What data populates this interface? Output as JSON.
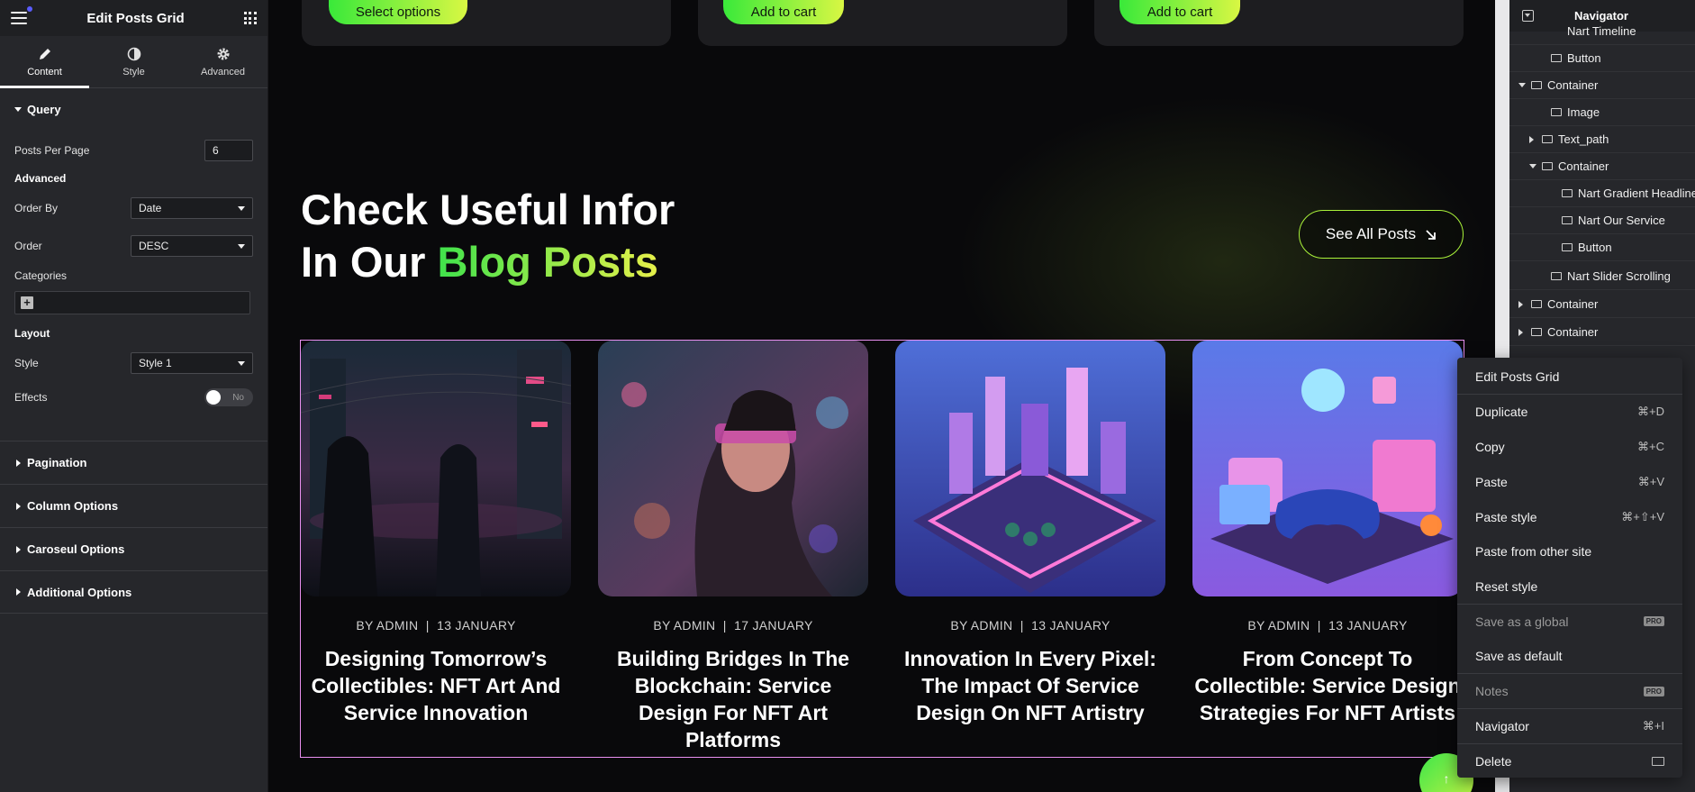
{
  "panel": {
    "title": "Edit Posts Grid",
    "tabs": [
      {
        "label": "Content",
        "icon": "pencil-icon"
      },
      {
        "label": "Style",
        "icon": "half-circle-icon"
      },
      {
        "label": "Advanced",
        "icon": "gear-icon"
      }
    ],
    "query": {
      "heading": "Query",
      "posts_per_page_label": "Posts Per Page",
      "posts_per_page_value": "6",
      "advanced_heading": "Advanced",
      "order_by_label": "Order By",
      "order_by_value": "Date",
      "order_label": "Order",
      "order_value": "DESC",
      "categories_label": "Categories",
      "layout_heading": "Layout",
      "style_label": "Style",
      "style_value": "Style 1",
      "effects_label": "Effects",
      "effects_value": "No"
    },
    "sections": [
      "Pagination",
      "Column Options",
      "Caroseul Options",
      "Additional Options"
    ]
  },
  "canvas": {
    "top_buttons": [
      "Select options",
      "Add to cart",
      "Add to cart"
    ],
    "headline_line1": "Check Useful Infor",
    "headline_line2_plain": "In Our ",
    "headline_line2_highlight": "Blog Posts",
    "see_all": "See All Posts",
    "posts": [
      {
        "author": "BY ADMIN",
        "date": "13 JANUARY",
        "title": "Designing Tomorrow’s Collectibles: NFT Art And Service Innovation"
      },
      {
        "author": "BY ADMIN",
        "date": "17 JANUARY",
        "title": "Building Bridges In The Blockchain: Service Design For NFT Art Platforms"
      },
      {
        "author": "BY ADMIN",
        "date": "13 JANUARY",
        "title": "Innovation In Every Pixel: The Impact Of Service Design On NFT Artistry"
      },
      {
        "author": "BY ADMIN",
        "date": "13 JANUARY",
        "title": "From Concept To Collectible: Service Design Strategies For NFT Artists"
      }
    ],
    "meta_separator": "|",
    "accent_colors": {
      "green": "#3fe24b",
      "yellow": "#e6f04a",
      "selection": "#e98ff0"
    }
  },
  "navigator": {
    "title": "Navigator",
    "items": [
      {
        "label": "Nart Timeline"
      },
      {
        "label": "Button"
      },
      {
        "label": "Container"
      },
      {
        "label": "Image"
      },
      {
        "label": "Text_path"
      },
      {
        "label": "Container"
      },
      {
        "label": "Nart Gradient Headline"
      },
      {
        "label": "Nart Our Service"
      },
      {
        "label": "Button"
      },
      {
        "label": "Nart Slider Scrolling"
      },
      {
        "label": "Container"
      },
      {
        "label": "Container"
      }
    ]
  },
  "context_menu": {
    "items": [
      {
        "label": "Edit Posts Grid",
        "shortcut": ""
      },
      {
        "label": "Duplicate",
        "shortcut": "⌘+D"
      },
      {
        "label": "Copy",
        "shortcut": "⌘+C"
      },
      {
        "label": "Paste",
        "shortcut": "⌘+V"
      },
      {
        "label": "Paste style",
        "shortcut": "⌘+⇧+V"
      },
      {
        "label": "Paste from other site",
        "shortcut": ""
      },
      {
        "label": "Reset style",
        "shortcut": ""
      },
      {
        "label": "Save as a global",
        "shortcut": "",
        "badge": "PRO"
      },
      {
        "label": "Save as default",
        "shortcut": ""
      },
      {
        "label": "Notes",
        "shortcut": "",
        "badge": "PRO"
      },
      {
        "label": "Navigator",
        "shortcut": "⌘+I"
      },
      {
        "label": "Delete",
        "shortcut": ""
      }
    ]
  }
}
